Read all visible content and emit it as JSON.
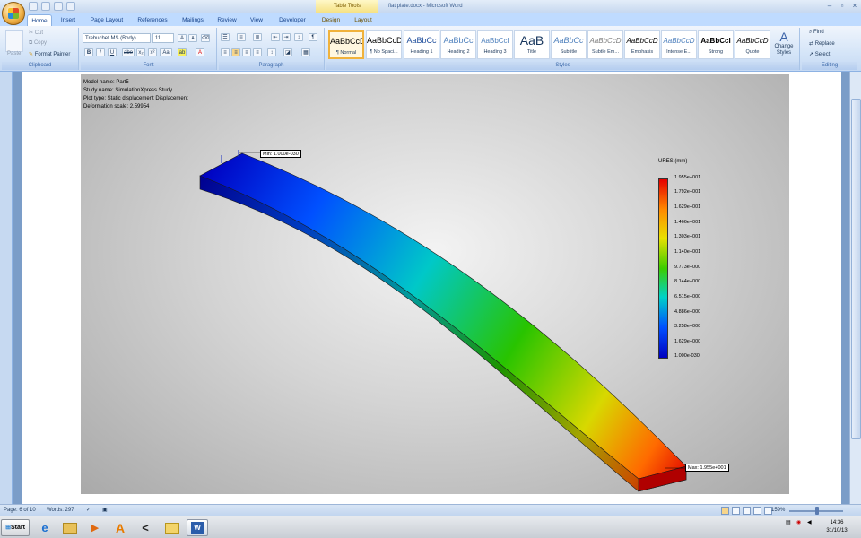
{
  "window": {
    "title": "flat plate.docx - Microsoft Word",
    "context_tab": "Table Tools"
  },
  "tabs": [
    "Home",
    "Insert",
    "Page Layout",
    "References",
    "Mailings",
    "Review",
    "View",
    "Developer",
    "Design",
    "Layout"
  ],
  "active_tab": "Home",
  "ribbon": {
    "clipboard": {
      "label": "Clipboard",
      "paste": "Paste",
      "cut": "Cut",
      "copy": "Copy",
      "format_painter": "Format Painter"
    },
    "font": {
      "label": "Font",
      "font_name": "Trebuchet MS (Body)",
      "font_size": "11",
      "bold": "B",
      "italic": "I",
      "underline": "U",
      "strike": "abe",
      "sub": "x₂",
      "sup": "x²",
      "change_case": "Aa",
      "grow": "A",
      "shrink": "A"
    },
    "paragraph": {
      "label": "Paragraph"
    },
    "styles": {
      "label": "Styles",
      "items": [
        {
          "preview": "AaBbCcD",
          "name": "¶ Normal"
        },
        {
          "preview": "AaBbCcD",
          "name": "¶ No Spaci..."
        },
        {
          "preview": "AaBbCc",
          "name": "Heading 1"
        },
        {
          "preview": "AaBbCc",
          "name": "Heading 2"
        },
        {
          "preview": "AaBbCcI",
          "name": "Heading 3"
        },
        {
          "preview": "AaB",
          "name": "Title"
        },
        {
          "preview": "AaBbCc",
          "name": "Subtitle"
        },
        {
          "preview": "AaBbCcD",
          "name": "Subtle Em..."
        },
        {
          "preview": "AaBbCcD",
          "name": "Emphasis"
        },
        {
          "preview": "AaBbCcD",
          "name": "Intense E..."
        },
        {
          "preview": "AaBbCcI",
          "name": "Strong"
        },
        {
          "preview": "AaBbCcD",
          "name": "Quote"
        }
      ],
      "selected_index": 0,
      "change_styles": "Change Styles"
    },
    "editing": {
      "label": "Editing",
      "find": "Find",
      "replace": "Replace",
      "select": "Select"
    }
  },
  "simulation": {
    "model_name": "Model name: Part5",
    "study_name": "Study name: SimulationXpress Study",
    "plot_type": "Plot type: Static displacement Displacement",
    "deformation_scale": "Deformation scale: 2.59954",
    "min_marker": "Min: 1.000e-030",
    "max_marker": "Max: 1.955e+001",
    "legend_title": "URES (mm)",
    "legend_values": [
      "1.955e+001",
      "1.792e+001",
      "1.629e+001",
      "1.466e+001",
      "1.303e+001",
      "1.140e+001",
      "9.773e+000",
      "8.144e+000",
      "6.515e+000",
      "4.886e+000",
      "3.258e+000",
      "1.629e+000",
      "1.000e-030"
    ],
    "colors": {
      "min": "#0000c0",
      "max": "#e50000"
    }
  },
  "status": {
    "page": "Page: 6 of 10",
    "words": "Words: 297",
    "zoom": "159%"
  },
  "taskbar": {
    "start": "Start",
    "time": "14:36",
    "date": "31/10/13"
  }
}
